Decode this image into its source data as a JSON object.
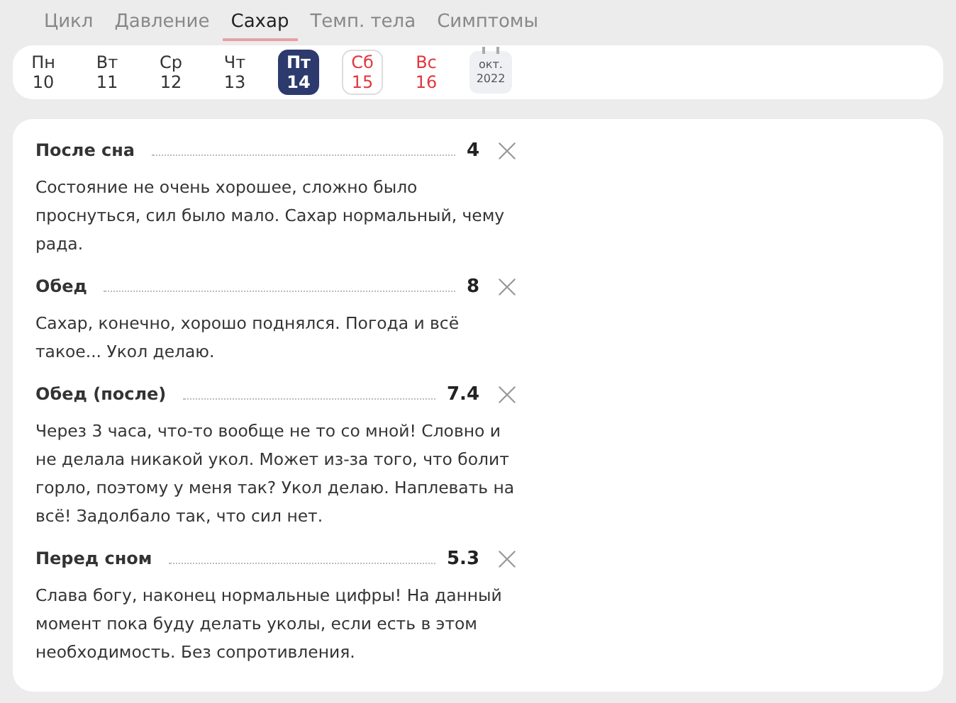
{
  "tabs": [
    {
      "label": "Цикл",
      "selected": false
    },
    {
      "label": "Давление",
      "selected": false
    },
    {
      "label": "Сахар",
      "selected": true
    },
    {
      "label": "Темп. тела",
      "selected": false
    },
    {
      "label": "Симптомы",
      "selected": false
    }
  ],
  "week": [
    {
      "day": "Пн",
      "date": "10",
      "kind": "weekday",
      "selected": false,
      "today": false
    },
    {
      "day": "Вт",
      "date": "11",
      "kind": "weekday",
      "selected": false,
      "today": false
    },
    {
      "day": "Ср",
      "date": "12",
      "kind": "weekday",
      "selected": false,
      "today": false
    },
    {
      "day": "Чт",
      "date": "13",
      "kind": "weekday",
      "selected": false,
      "today": false
    },
    {
      "day": "Пт",
      "date": "14",
      "kind": "weekday",
      "selected": true,
      "today": false
    },
    {
      "day": "Сб",
      "date": "15",
      "kind": "weekend",
      "selected": false,
      "today": true
    },
    {
      "day": "Вс",
      "date": "16",
      "kind": "weekend",
      "selected": false,
      "today": false
    }
  ],
  "calendar_button": {
    "month": "окт.",
    "year": "2022"
  },
  "entries": [
    {
      "title": "После сна",
      "value": "4",
      "note": "Состояние не очень хорошее, сложно было проснуться, сил было мало. Сахар нормальный, чему рада."
    },
    {
      "title": "Обед",
      "value": "8",
      "note": "Сахар, конечно, хорошо поднялся. Погода и всё такое... Укол делаю."
    },
    {
      "title": "Обед (после)",
      "value": "7.4",
      "note": "Через 3 часа, что-то вообще не то со мной! Словно и не делала никакой укол. Может из-за того, что болит горло, поэтому у меня так? Укол делаю. Наплевать на всё! Задолбало так, что сил нет."
    },
    {
      "title": "Перед сном",
      "value": "5.3",
      "note": "Слава богу, наконец нормальные цифры! На данный момент пока буду делать уколы, если есть в этом необходимость. Без сопротивления."
    }
  ]
}
